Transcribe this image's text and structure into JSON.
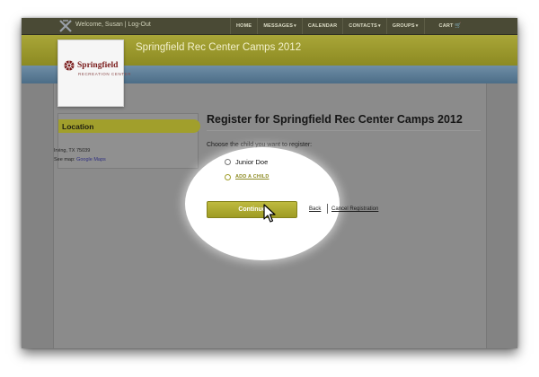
{
  "header": {
    "welcome": "Welcome, Susan | Log-Out",
    "nav": [
      {
        "label": "HOME",
        "caret": ""
      },
      {
        "label": "MESSAGES",
        "caret": "▾"
      },
      {
        "label": "CALENDAR",
        "caret": ""
      },
      {
        "label": "CONTACTS",
        "caret": "▾"
      },
      {
        "label": "GROUPS",
        "caret": "▾"
      }
    ],
    "cart": "CART",
    "cart_icon": "🛒"
  },
  "site": {
    "title": "Springfield Rec Center Camps 2012",
    "logo_name": "Springfield",
    "logo_sub": "RECREATION CENTER"
  },
  "sidebar": {
    "location_title": "Location",
    "city": "Irving, TX 75039",
    "map_prefix": "See map: ",
    "map_link": "Google Maps"
  },
  "main": {
    "heading": "Register for Springfield Rec Center Camps 2012",
    "choose_label": "Choose the child you want to register:",
    "children": [
      {
        "label": "Junior Doe",
        "selected": false
      },
      {
        "label": "ADD A CHILD",
        "selected": false
      }
    ],
    "continue_label": "Continue",
    "back_label": "Back",
    "cancel_label": "Cancel Registration"
  },
  "colors": {
    "accent_olive": "#a19f2c",
    "topbar": "#4a4a35",
    "blue_band": "#5a7a94",
    "logo_red": "#7a1c1c"
  }
}
